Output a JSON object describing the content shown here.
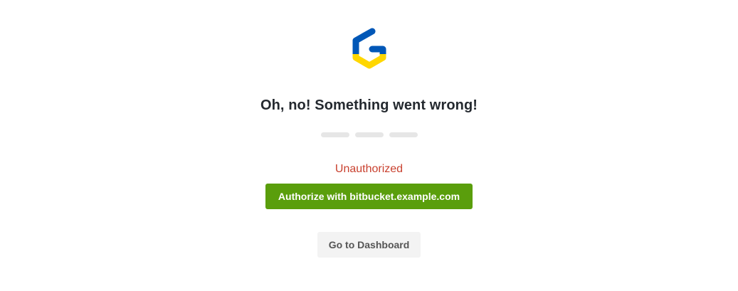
{
  "logo": {
    "icon": "gitpod-logo-icon",
    "colors": {
      "top": "#0057b7",
      "bottom": "#ffd700"
    }
  },
  "error_page": {
    "title": "Oh, no! Something went wrong!",
    "error_message": "Unauthorized",
    "authorize_button_label": "Authorize with bitbucket.example.com",
    "dashboard_button_label": "Go to Dashboard"
  },
  "colors": {
    "error_text": "#c9412f",
    "primary_button": "#5a9e0c",
    "secondary_button": "#f3f3f3"
  }
}
